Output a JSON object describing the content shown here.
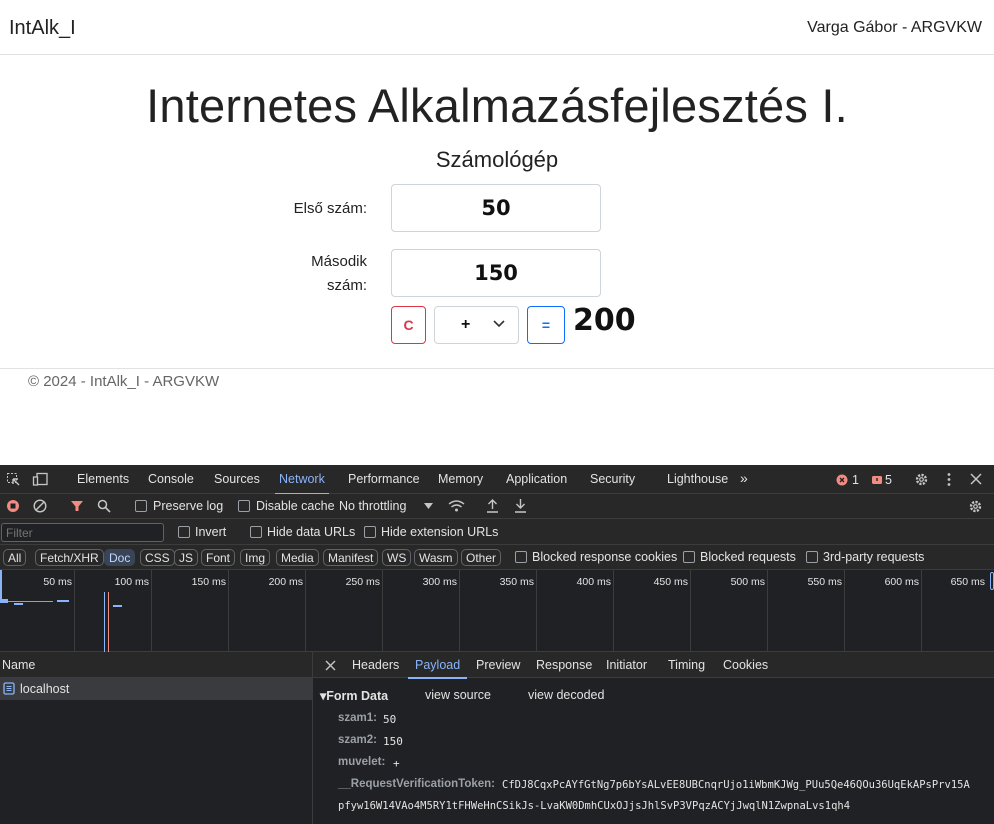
{
  "navbar": {
    "brand": "IntAlk_I",
    "user": "Varga Gábor - ARGVKW"
  },
  "page": {
    "title": "Internetes Alkalmazásfejlesztés I.",
    "subtitle": "Számológép",
    "first_label": "Első szám:",
    "first_value": "50",
    "second_label_line1": "Második",
    "second_label_line2": "szám:",
    "second_value": "150",
    "clear_label": "C",
    "operator_value": "+",
    "equals_label": "=",
    "result": "200"
  },
  "footer": {
    "text": "© 2024 - IntAlk_I - ARGVKW"
  },
  "devtools": {
    "tabs": [
      "Elements",
      "Console",
      "Sources",
      "Network",
      "Performance",
      "Memory",
      "Application",
      "Security",
      "Lighthouse"
    ],
    "active_tab": "Network",
    "more_tabs": "»",
    "error_count": "1",
    "warning_count": "5",
    "preserve_log": "Preserve log",
    "disable_cache": "Disable cache",
    "throttling": "No throttling",
    "filter_placeholder": "Filter",
    "invert": "Invert",
    "hide_data_urls": "Hide data URLs",
    "hide_extension_urls": "Hide extension URLs",
    "types": [
      "All",
      "Fetch/XHR",
      "Doc",
      "CSS",
      "JS",
      "Font",
      "Img",
      "Media",
      "Manifest",
      "WS",
      "Wasm",
      "Other"
    ],
    "active_type": "Doc",
    "blocked_response_cookies": "Blocked response cookies",
    "blocked_requests": "Blocked requests",
    "third_party_requests": "3rd-party requests",
    "timeline_ticks": [
      "50 ms",
      "100 ms",
      "150 ms",
      "200 ms",
      "250 ms",
      "300 ms",
      "350 ms",
      "400 ms",
      "450 ms",
      "500 ms",
      "550 ms",
      "600 ms",
      "650 ms"
    ],
    "name_header": "Name",
    "request_name": "localhost",
    "detail_tabs": [
      "Headers",
      "Payload",
      "Preview",
      "Response",
      "Initiator",
      "Timing",
      "Cookies"
    ],
    "active_detail_tab": "Payload",
    "form_data_title": "▾Form Data",
    "view_source": "view source",
    "view_decoded": "view decoded",
    "form_fields": [
      {
        "key": "szam1:",
        "value": "50"
      },
      {
        "key": "szam2:",
        "value": "150"
      },
      {
        "key": "muvelet:",
        "value": "+"
      },
      {
        "key": "__RequestVerificationToken:",
        "value": "CfDJ8CqxPcAYfGtNg7p6bYsALvEE8UBCnqrUjo1iWbmKJWg_PUu5Qe46QOu36UqEkAPsPrv15A"
      }
    ],
    "token_line2": "pfyw16W14VAo4M5RY1tFHWeHnCSikJs-LvaKW0DmhCUxOJjsJhlSvP3VPqzACYjJwqlN1ZwpnaLvs1qh4"
  }
}
